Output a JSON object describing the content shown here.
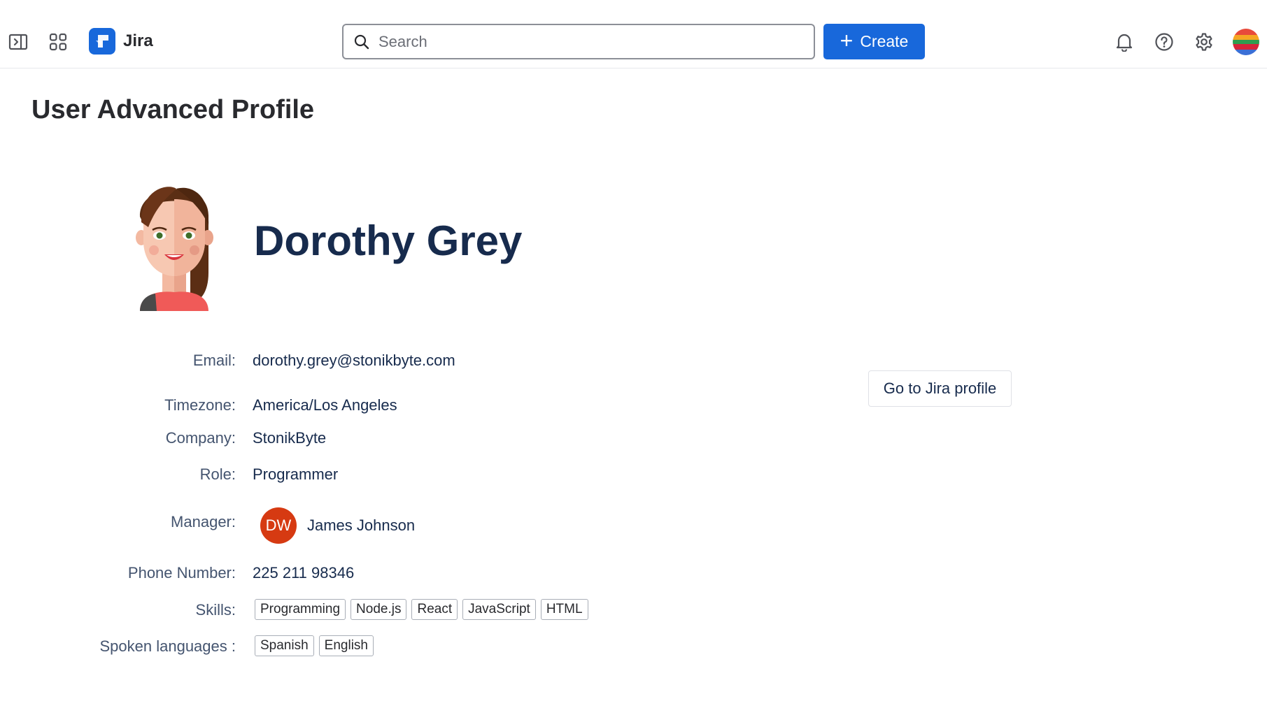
{
  "header": {
    "app_name": "Jira",
    "search_placeholder": "Search",
    "create_label": "Create",
    "brand_color": "#1868db"
  },
  "page": {
    "title": "User Advanced Profile"
  },
  "profile": {
    "name": "Dorothy Grey",
    "fields": {
      "email_label": "Email:",
      "email": "dorothy.grey@stonikbyte.com",
      "timezone_label": "Timezone:",
      "timezone": "America/Los Angeles",
      "company_label": "Company:",
      "company": "StonikByte",
      "role_label": "Role:",
      "role": "Programmer",
      "manager_label": "Manager:",
      "manager_initials": "DW",
      "manager_name": "James Johnson",
      "phone_label": "Phone Number:",
      "phone": "225 211 98346",
      "skills_label": "Skills:",
      "skills": [
        "Programming",
        "Node.js",
        "React",
        "JavaScript",
        "HTML"
      ],
      "languages_label": "Spoken languages :",
      "languages": [
        "Spanish",
        "English"
      ]
    },
    "manager_avatar_color": "#d63a12"
  },
  "actions": {
    "jira_profile_label": "Go to Jira profile"
  }
}
